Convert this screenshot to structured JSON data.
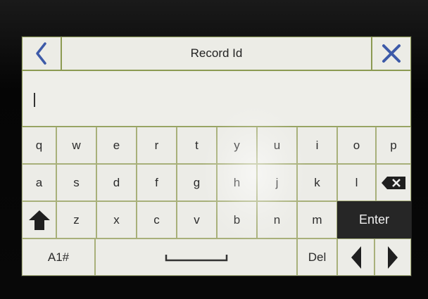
{
  "header": {
    "title": "Record Id",
    "back_icon": "chevron-left-icon",
    "close_icon": "close-icon",
    "accent_color": "#3d5aa8"
  },
  "input": {
    "value": ""
  },
  "keyboard": {
    "row1": [
      "q",
      "w",
      "e",
      "r",
      "t",
      "y",
      "u",
      "i",
      "o",
      "p"
    ],
    "row2": [
      "a",
      "s",
      "d",
      "f",
      "g",
      "h",
      "j",
      "k",
      "l"
    ],
    "row2_backspace_icon": "backspace-icon",
    "row3": [
      "z",
      "x",
      "c",
      "v",
      "b",
      "n",
      "m"
    ],
    "row3_shift_icon": "shift-icon",
    "enter_label": "Enter",
    "mode_label": "A1#",
    "space_icon": "space-icon",
    "del_label": "Del",
    "left_arrow_icon": "arrow-left-icon",
    "right_arrow_icon": "arrow-right-icon"
  }
}
